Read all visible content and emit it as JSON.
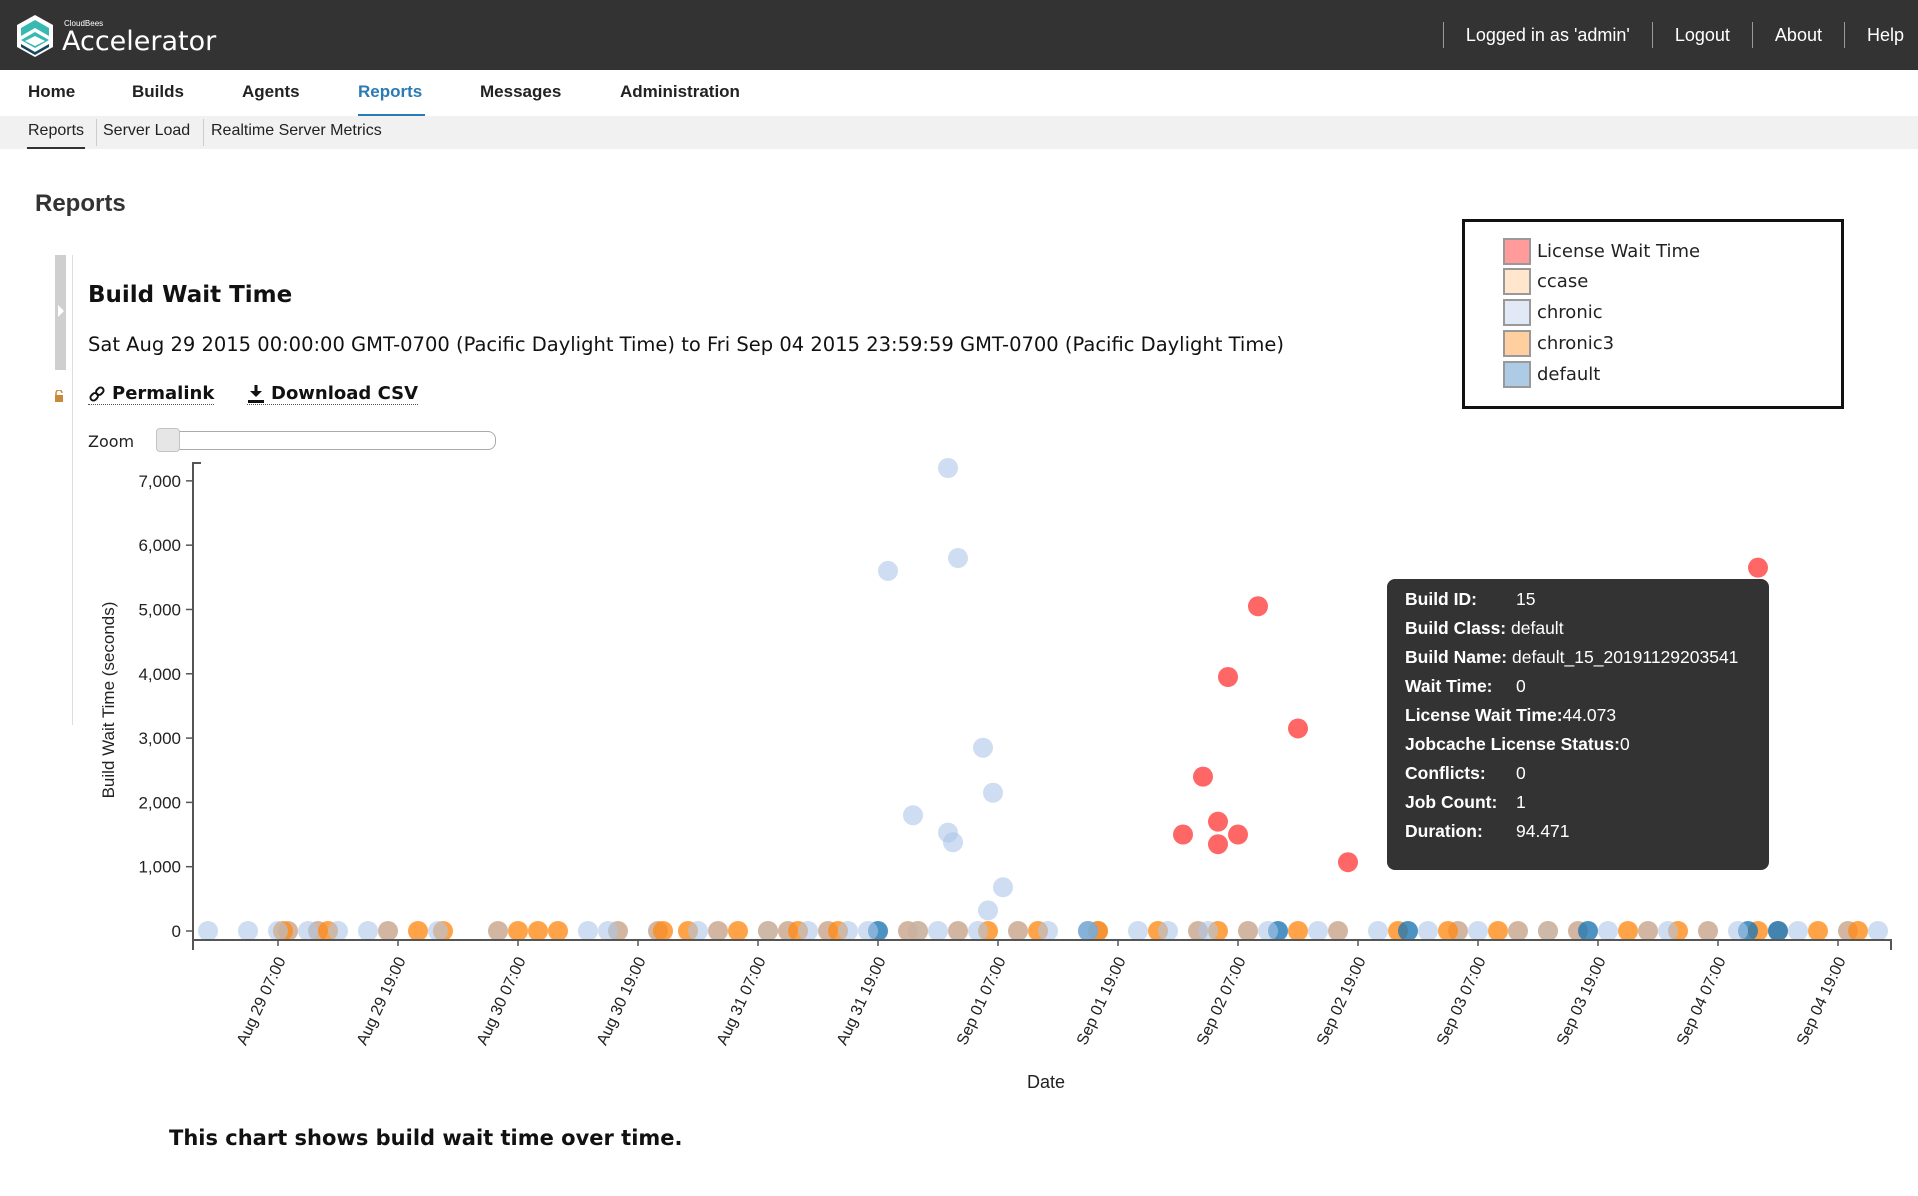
{
  "header": {
    "brand_small": "CloudBees",
    "brand": "Accelerator",
    "logged_in": "Logged in as 'admin'",
    "logout": "Logout",
    "about": "About",
    "help": "Help"
  },
  "nav": {
    "items": [
      {
        "label": "Home"
      },
      {
        "label": "Builds"
      },
      {
        "label": "Agents"
      },
      {
        "label": "Reports",
        "active": true
      },
      {
        "label": "Messages"
      },
      {
        "label": "Administration"
      }
    ]
  },
  "subnav": {
    "items": [
      {
        "label": "Reports",
        "active": true
      },
      {
        "label": "Server Load"
      },
      {
        "label": "Realtime Server Metrics"
      }
    ]
  },
  "page": {
    "title": "Reports"
  },
  "report": {
    "title": "Build Wait Time",
    "range": "Sat Aug 29 2015 00:00:00 GMT-0700 (Pacific Daylight Time) to Fri Sep 04 2015 23:59:59 GMT-0700 (Pacific Daylight Time)",
    "permalink": "Permalink",
    "download_csv": "Download CSV",
    "zoom_label": "Zoom",
    "zoom_value": 0,
    "footer_note": "This chart shows build wait time over time."
  },
  "legend": {
    "items": [
      {
        "label": "License Wait Time",
        "color": "#ff9b9b"
      },
      {
        "label": "ccase",
        "color": "#ffe6cc"
      },
      {
        "label": "chronic",
        "color": "#e1e9f6"
      },
      {
        "label": "chronic3",
        "color": "#ffcf9f"
      },
      {
        "label": "default",
        "color": "#aecbe6"
      }
    ]
  },
  "tooltip": {
    "rows": [
      {
        "label": "Build ID:",
        "value": "15"
      },
      {
        "label": "Build Class:",
        "value": "default"
      },
      {
        "label": "Build Name:",
        "value": "default_15_20191129203541"
      },
      {
        "label": "Wait Time:",
        "value": "0"
      },
      {
        "label": "License Wait Time:",
        "value": "44.073"
      },
      {
        "label": "Jobcache License Status:",
        "value": "0"
      },
      {
        "label": "Conflicts:",
        "value": "0"
      },
      {
        "label": "Job Count:",
        "value": "1"
      },
      {
        "label": "Duration:",
        "value": "94.471"
      }
    ]
  },
  "chart_data": {
    "type": "scatter",
    "title": "Build Wait Time",
    "xlabel": "Date",
    "ylabel": "Build Wait Time (seconds)",
    "ylim": [
      0,
      7200
    ],
    "yticks": [
      "0",
      "1,000",
      "2,000",
      "3,000",
      "4,000",
      "5,000",
      "6,000",
      "7,000"
    ],
    "ytick_values": [
      0,
      1000,
      2000,
      3000,
      4000,
      5000,
      6000,
      7000
    ],
    "x_unit": "hours since Aug 29 00:00",
    "xlim": [
      0,
      168
    ],
    "xticks": [
      "Aug 29 07:00",
      "Aug 29 19:00",
      "Aug 30 07:00",
      "Aug 30 19:00",
      "Aug 31 07:00",
      "Aug 31 19:00",
      "Sep 01 07:00",
      "Sep 01 19:00",
      "Sep 02 07:00",
      "Sep 02 19:00",
      "Sep 03 07:00",
      "Sep 03 19:00",
      "Sep 04 07:00",
      "Sep 04 19:00"
    ],
    "xtick_values": [
      7,
      19,
      31,
      43,
      55,
      67,
      79,
      91,
      103,
      115,
      127,
      139,
      151,
      163
    ],
    "grid": false,
    "legend_position": "top-right",
    "series": [
      {
        "name": "License Wait Time",
        "color": "#ff6666",
        "points": [
          [
            97.5,
            1500
          ],
          [
            99.5,
            2400
          ],
          [
            101,
            1700
          ],
          [
            101,
            1350
          ],
          [
            102,
            3950
          ],
          [
            103,
            1500
          ],
          [
            105,
            5050
          ],
          [
            109,
            3150
          ],
          [
            114,
            1070
          ],
          [
            155,
            5650
          ]
        ]
      },
      {
        "name": "chronic",
        "color": "#aec7e8",
        "points": [
          [
            68,
            5600
          ],
          [
            70.5,
            1800
          ],
          [
            74,
            7200
          ],
          [
            74,
            1530
          ],
          [
            74.5,
            1380
          ],
          [
            75,
            5800
          ],
          [
            77.5,
            2850
          ],
          [
            78,
            320
          ],
          [
            78.5,
            2150
          ],
          [
            79.5,
            680
          ],
          [
            0,
            0
          ],
          [
            4,
            0
          ],
          [
            7,
            0
          ],
          [
            10,
            0
          ],
          [
            13,
            0
          ],
          [
            16,
            0
          ],
          [
            23,
            0
          ],
          [
            38,
            0
          ],
          [
            40,
            0
          ],
          [
            49,
            0
          ],
          [
            56,
            0
          ],
          [
            60,
            0
          ],
          [
            64,
            0
          ],
          [
            66,
            0
          ],
          [
            71,
            0
          ],
          [
            73,
            0
          ],
          [
            77,
            0
          ],
          [
            84,
            0
          ],
          [
            88,
            0
          ],
          [
            93,
            0
          ],
          [
            96,
            0
          ],
          [
            100,
            0
          ],
          [
            106,
            0
          ],
          [
            111,
            0
          ],
          [
            117,
            0
          ],
          [
            122,
            0
          ],
          [
            127,
            0
          ],
          [
            134,
            0
          ],
          [
            140,
            0
          ],
          [
            146,
            0
          ],
          [
            153,
            0
          ],
          [
            159,
            0
          ],
          [
            167,
            0
          ]
        ]
      },
      {
        "name": "ccase",
        "color": "#c8a48a",
        "points": [
          [
            8,
            0
          ],
          [
            11,
            0
          ],
          [
            18,
            0
          ],
          [
            29,
            0
          ],
          [
            41,
            0
          ],
          [
            45,
            0
          ],
          [
            51,
            0
          ],
          [
            58,
            0
          ],
          [
            62,
            0
          ],
          [
            70,
            0
          ],
          [
            75,
            0
          ],
          [
            81,
            0
          ],
          [
            89,
            0
          ],
          [
            99,
            0
          ],
          [
            104,
            0
          ],
          [
            113,
            0
          ],
          [
            125,
            0
          ],
          [
            131,
            0
          ],
          [
            137,
            0
          ],
          [
            144,
            0
          ],
          [
            150,
            0
          ],
          [
            157,
            0
          ],
          [
            164,
            0
          ]
        ]
      },
      {
        "name": "chronic3",
        "color": "#ff8c1a",
        "points": [
          [
            7.5,
            0
          ],
          [
            12,
            0
          ],
          [
            21,
            0
          ],
          [
            23.5,
            0
          ],
          [
            31,
            0
          ],
          [
            33,
            0
          ],
          [
            35,
            0
          ],
          [
            45.5,
            0
          ],
          [
            48,
            0
          ],
          [
            53,
            0
          ],
          [
            56,
            0
          ],
          [
            59,
            0
          ],
          [
            63,
            0
          ],
          [
            71,
            0
          ],
          [
            78,
            0
          ],
          [
            83,
            0
          ],
          [
            89,
            0
          ],
          [
            95,
            0
          ],
          [
            101,
            0
          ],
          [
            109,
            0
          ],
          [
            119,
            0
          ],
          [
            124,
            0
          ],
          [
            129,
            0
          ],
          [
            134,
            0
          ],
          [
            142,
            0
          ],
          [
            147,
            0
          ],
          [
            155,
            0
          ],
          [
            161,
            0
          ],
          [
            165,
            0
          ]
        ]
      },
      {
        "name": "default",
        "color": "#1f77b4",
        "points": [
          [
            67,
            0
          ],
          [
            88,
            0
          ],
          [
            107,
            0
          ],
          [
            120,
            0
          ],
          [
            138,
            0
          ],
          [
            154,
            0
          ],
          [
            157,
            0
          ]
        ]
      }
    ]
  }
}
